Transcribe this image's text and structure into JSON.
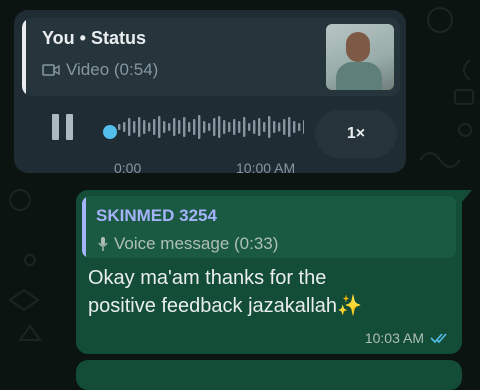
{
  "status_reply": {
    "quote_title": "You • Status",
    "quote_subtitle": "Video (0:54)",
    "elapsed": "0:00",
    "timestamp": "10:00 AM",
    "speed": "1×",
    "playback_progress": 0.0
  },
  "outgoing_message": {
    "quote_sender": "SKINMED 3254",
    "quote_subtitle": "Voice message (0:33)",
    "text_line1": "Okay ma'am thanks for the",
    "text_line2": "positive feedback jazakallah✨",
    "timestamp": "10:03 AM",
    "read_status": "read"
  },
  "colors": {
    "accent_blue": "#53bdeb",
    "outgoing_bg": "#144d37",
    "incoming_bg": "#1f2c34",
    "quote_name_purple": "#a5b3fb"
  }
}
